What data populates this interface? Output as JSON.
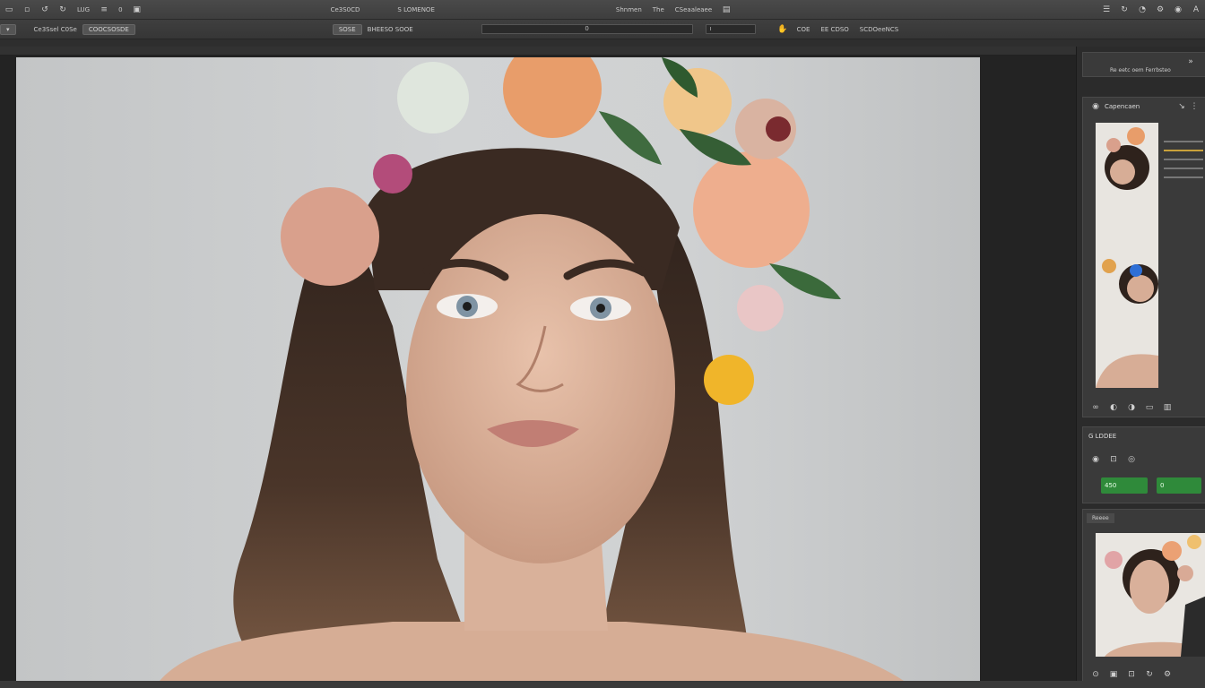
{
  "menubar": {
    "left_text": "LUG",
    "left_num": "0",
    "center_title": "Ce3S0CD",
    "center_sub": "S LOMENOE",
    "menu_a": "Shnmen",
    "menu_b": "The",
    "menu_c": "CSeaaleaee"
  },
  "options": {
    "preset": "Ce3Ssel  C0Se",
    "mode": "COOCSOSDE",
    "tool_label": "SOSE",
    "tool_value": "BHEESO SOOE",
    "field_value": "0",
    "extra_a": "COE",
    "extra_b": "EE CDSO",
    "extra_c": "SCDOeeNCS"
  },
  "dock": {
    "header_text": "Re eetc oem Ferrbsteo",
    "properties_title": "Capencaen",
    "adjust_title": "G LDDEE",
    "stat_a": "450",
    "stat_b": "0",
    "swatch_label": "Reeee"
  },
  "colors": {
    "accent_green": "#2f8a3a",
    "chrome": "#3e3e3e",
    "canvas_bg": "#232323"
  }
}
